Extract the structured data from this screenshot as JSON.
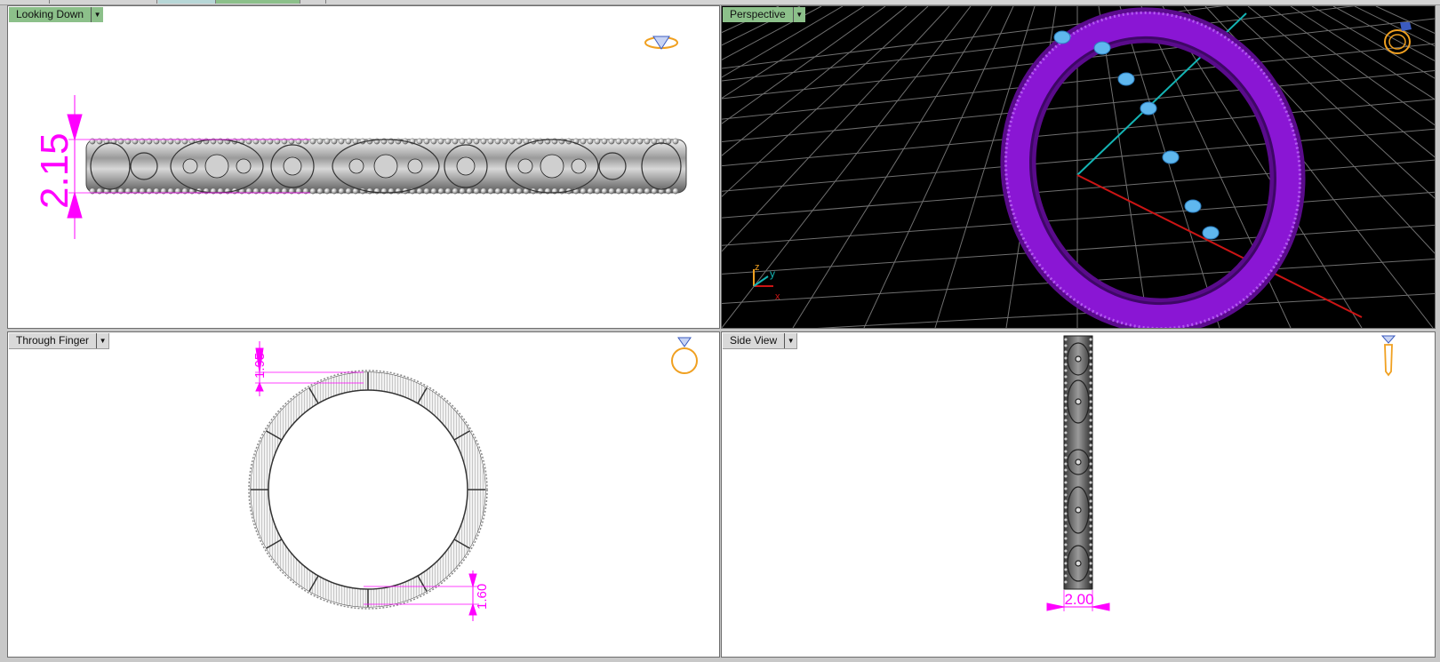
{
  "viewports": {
    "top_left": {
      "label": "Looking Down"
    },
    "top_right": {
      "label": "Perspective"
    },
    "bottom_left": {
      "label": "Through Finger"
    },
    "bottom_right": {
      "label": "Side View"
    }
  },
  "dimensions": {
    "looking_down_height": "2.15",
    "through_finger_top": "1.95",
    "through_finger_bottom": "1.60",
    "side_view_width": "2.00"
  },
  "axis": {
    "z": "z",
    "y": "y",
    "x": "x"
  },
  "colors": {
    "dimension": "#ff00ff",
    "active_label": "#8cc08a",
    "render_purple": "#8a16d4",
    "stone_blue": "#5fb7ee",
    "axis_x": "#cc1414",
    "axis_y": "#14b4b4",
    "gizmo": "#f0a020"
  },
  "icons": {
    "looking_down": "ring-top-view-icon",
    "perspective": "ring-perspective-icon",
    "through_finger": "ring-front-view-icon",
    "side_view": "ring-side-view-icon"
  }
}
